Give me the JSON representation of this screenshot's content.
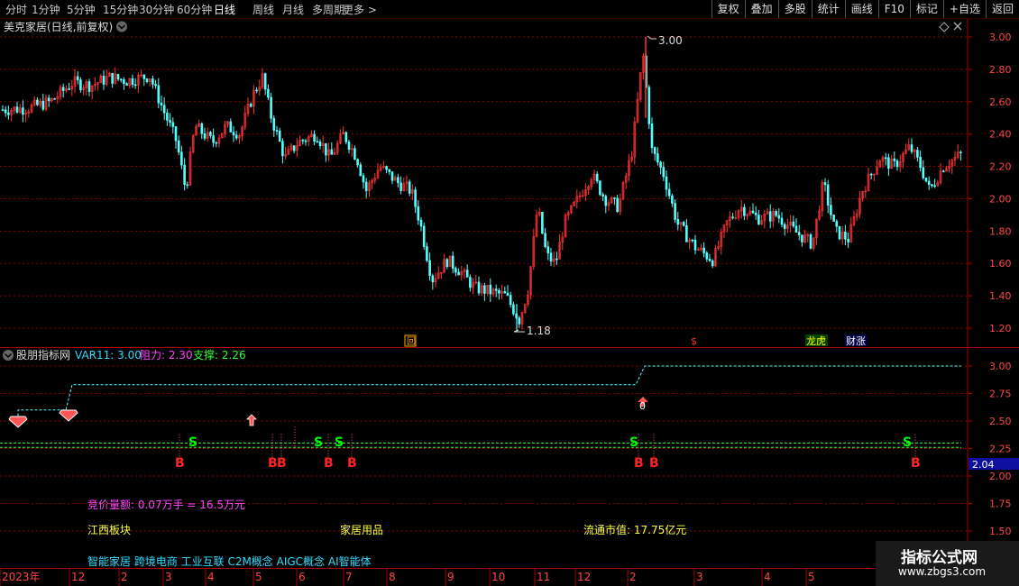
{
  "toolbar": {
    "periods": [
      "分时",
      "1分钟",
      "5分钟",
      "15分钟",
      "30分钟",
      "60分钟",
      "日线",
      "周线",
      "月线",
      "多周期",
      "更多 >"
    ],
    "active_period": "日线",
    "right_buttons": [
      "复权",
      "叠加",
      "多股",
      "统计",
      "画线",
      "F10",
      "标记",
      "+自选",
      "返回"
    ]
  },
  "main_chart": {
    "title": "美克家居(日线,前复权)",
    "high_label": "3.00",
    "low_label": "1.18",
    "y_ticks": [
      "3.00",
      "2.80",
      "2.60",
      "2.40",
      "2.20",
      "2.00",
      "1.80",
      "1.60",
      "1.40",
      "1.20"
    ],
    "y_range": [
      1.1,
      3.08
    ],
    "markers": {
      "hui": "回",
      "s": "$",
      "longhu": "龙虎",
      "caizhang": "财涨"
    }
  },
  "indicator": {
    "name": "股朋指标网",
    "var_label": "VAR11: 3.00",
    "resist_label": "阻力: 2.30",
    "support_label": "支撑: 2.26",
    "y_ticks": [
      "3.00",
      "2.75",
      "2.50",
      "2.25",
      "2.00",
      "1.75",
      "1.50"
    ],
    "y_range": [
      1.42,
      3.1
    ],
    "current_value": "2.04",
    "bid_volume": "竞价量额: 0.07万手 = 16.5万元",
    "sector": "江西板块",
    "industry": "家居用品",
    "float_cap": "流通市值: 17.75亿元",
    "concepts": "智能家居 跨境电商 工业互联 C2M概念 AIGC概念 AI智能体",
    "buy_label": "B",
    "sell_label": "S",
    "zero_label": "0"
  },
  "time_axis": [
    "2023年",
    "12",
    "2",
    "3",
    "4",
    "5",
    "6",
    "7",
    "8",
    "9",
    "10",
    "11",
    "12",
    "2",
    "3",
    "4",
    "5"
  ],
  "colors": {
    "up": "#ff3333",
    "down": "#55ffff",
    "grid": "#8b0000",
    "frame": "#aa0000",
    "axis_text": "#ff4444",
    "signal": "#00ff00",
    "magenta": "#ff44ff",
    "yellow": "#ffff44",
    "cyan": "#33ddff"
  },
  "watermark": {
    "line1": "指标公式网",
    "line2": "www.zbgs3.com"
  }
}
